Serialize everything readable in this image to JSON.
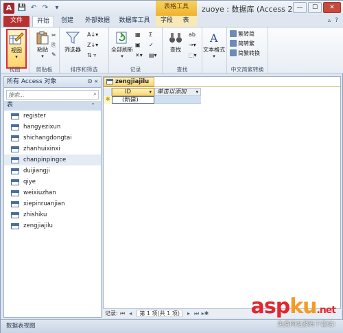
{
  "window": {
    "app_icon": "A",
    "contextual_title": "表格工具",
    "title": "zuoye : 数据库 (Access 2...",
    "buttons": [
      "—",
      "☐",
      "✕"
    ]
  },
  "qat": [
    "save-icon",
    "undo-icon",
    "redo-icon",
    "customize-icon"
  ],
  "tabs": [
    {
      "label": "文件"
    },
    {
      "label": "开始"
    },
    {
      "label": "创建"
    },
    {
      "label": "外部数据"
    },
    {
      "label": "数据库工具"
    },
    {
      "label": "字段"
    },
    {
      "label": "表"
    }
  ],
  "ribbon": {
    "groups": {
      "views": {
        "label": "视图",
        "btn": "视图"
      },
      "clipboard": {
        "label": "剪贴板",
        "paste": "粘贴"
      },
      "sort_filter": {
        "label": "排序和筛选",
        "filter": "筛选器"
      },
      "records": {
        "label": "记录",
        "refresh": "全部刷新"
      },
      "find": {
        "label": "查找",
        "find_btn": "查找"
      },
      "text": {
        "format": "文本格式"
      },
      "chinese": {
        "label": "中文简繁转换",
        "items": [
          "繁转简",
          "简转繁",
          "简繁转换"
        ]
      }
    }
  },
  "nav": {
    "title": "所有 Access 对象",
    "search_placeholder": "搜索...",
    "section": "表",
    "tables": [
      "register",
      "hangyezixun",
      "shichangdongtai",
      "zhanhuixinxi",
      "chanpinpingce",
      "duijiangji",
      "qiye",
      "weixiuzhan",
      "xiepinruanjian",
      "zhishiku",
      "zengjiajilu"
    ]
  },
  "doc": {
    "tab": "zengjiajilu",
    "col_id": "ID",
    "col_add": "单击以添加",
    "new_row": "(新建)"
  },
  "recnav": {
    "label": "记录:",
    "position": "第 1 项(共 1 项)"
  },
  "status": "数据表视图",
  "watermark": {
    "logo_a": "asp",
    "logo_b": "ku",
    "domain": ".net",
    "sub": "免费网站源码下载站!"
  }
}
